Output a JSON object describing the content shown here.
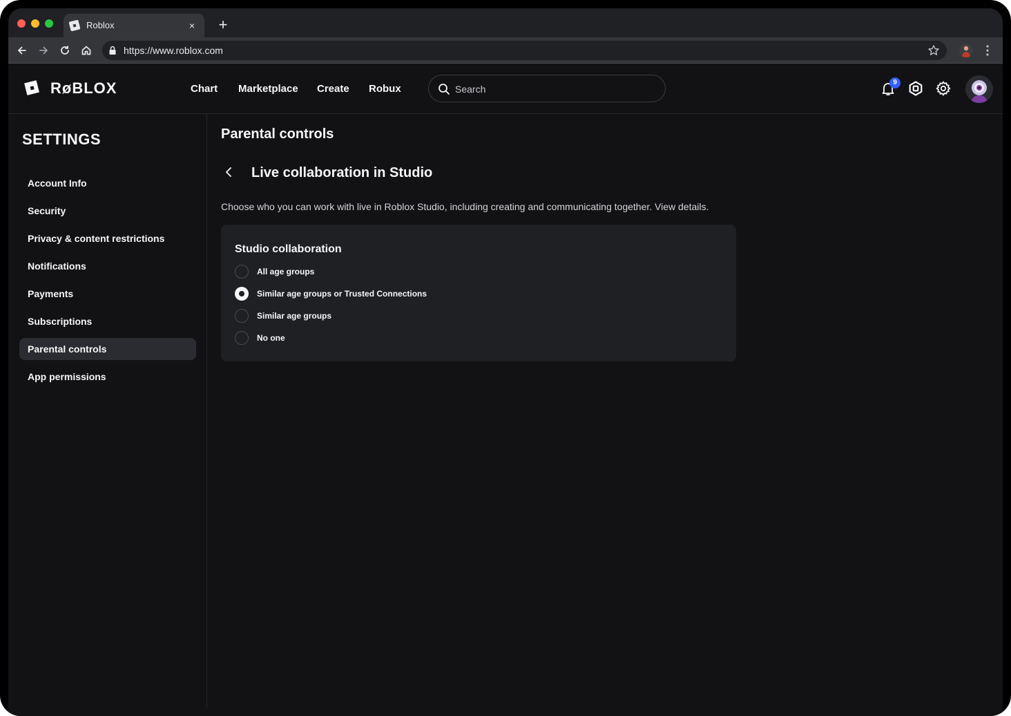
{
  "browser": {
    "tab_title": "Roblox",
    "tab_close_glyph": "×",
    "new_tab_glyph": "+",
    "url": "https://www.roblox.com",
    "icons": [
      "back-icon",
      "forward-icon",
      "reload-icon",
      "home-icon",
      "lock-icon",
      "star-icon",
      "profile-icon",
      "menu-icon"
    ]
  },
  "header": {
    "logo_text": "RøBLOX",
    "nav": [
      "Chart",
      "Marketplace",
      "Create",
      "Robux"
    ],
    "search_placeholder": "Search",
    "notification_count": "9",
    "icons": [
      "bell-icon",
      "robux-icon",
      "gear-icon",
      "avatar"
    ]
  },
  "sidebar": {
    "title": "SETTINGS",
    "items": [
      {
        "label": "Account Info",
        "active": false
      },
      {
        "label": "Security",
        "active": false
      },
      {
        "label": "Privacy & content restrictions",
        "active": false
      },
      {
        "label": "Notifications",
        "active": false
      },
      {
        "label": "Payments",
        "active": false
      },
      {
        "label": "Subscriptions",
        "active": false
      },
      {
        "label": "Parental controls",
        "active": true
      },
      {
        "label": "App permissions",
        "active": false
      }
    ]
  },
  "main": {
    "page_title": "Parental controls",
    "section_title": "Live collaboration in Studio",
    "description": "Choose who you can work with live in Roblox Studio, including creating and communicating together. View details.",
    "card": {
      "title": "Studio collaboration",
      "options": [
        {
          "label": "All age groups",
          "selected": false
        },
        {
          "label": "Similar age groups or Trusted Connections",
          "selected": true
        },
        {
          "label": "Similar age groups",
          "selected": false
        },
        {
          "label": "No one",
          "selected": false
        }
      ]
    }
  },
  "colors": {
    "background": "#121215",
    "card": "#1f2024",
    "accent_badge": "#335fff",
    "text": "#f7f7f8"
  }
}
